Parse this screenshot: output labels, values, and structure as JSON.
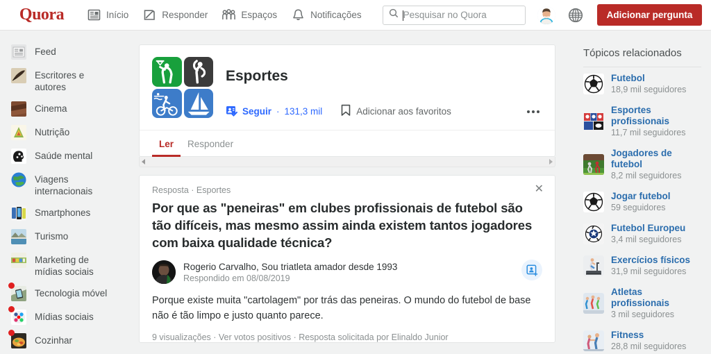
{
  "header": {
    "logo": "Quora",
    "nav": [
      {
        "label": "Início",
        "icon": "home-feed-icon"
      },
      {
        "label": "Responder",
        "icon": "pencil-answer-icon"
      },
      {
        "label": "Espaços",
        "icon": "spaces-people-icon"
      },
      {
        "label": "Notificações",
        "icon": "bell-icon"
      }
    ],
    "search": {
      "placeholder": "Pesquisar no Quora",
      "value": ""
    },
    "avatar": "user-avatar",
    "globe": "globe-language-icon",
    "add_question_label": "Adicionar pergunta",
    "accent_color": "#b92b27"
  },
  "sidebar": {
    "items": [
      {
        "label": "Feed",
        "icon": "feed-icon",
        "badge": false
      },
      {
        "label": "Escritores e autores",
        "icon": "writers-authors-icon",
        "badge": false
      },
      {
        "label": "Cinema",
        "icon": "cinema-icon",
        "badge": false
      },
      {
        "label": "Nutrição",
        "icon": "nutrition-icon",
        "badge": false
      },
      {
        "label": "Saúde mental",
        "icon": "mental-health-icon",
        "badge": false
      },
      {
        "label": "Viagens internacionais",
        "icon": "international-travel-icon",
        "badge": false
      },
      {
        "label": "Smartphones",
        "icon": "smartphones-icon",
        "badge": false
      },
      {
        "label": "Turismo",
        "icon": "tourism-icon",
        "badge": false
      },
      {
        "label": "Marketing de mídias sociais",
        "icon": "social-media-marketing-icon",
        "badge": false
      },
      {
        "label": "Tecnologia móvel",
        "icon": "mobile-technology-icon",
        "badge": true
      },
      {
        "label": "Mídias sociais",
        "icon": "social-media-icon",
        "badge": true
      },
      {
        "label": "Cozinhar",
        "icon": "cooking-icon",
        "badge": true
      }
    ]
  },
  "topic": {
    "title": "Esportes",
    "follow_label": "Seguir",
    "follow_separator": "·",
    "follow_count": "131,3 mil",
    "bookmark_label": "Adicionar aos favoritos",
    "more_label": "more-options",
    "tabs": [
      {
        "label": "Ler",
        "active": true
      },
      {
        "label": "Responder",
        "active": false
      }
    ]
  },
  "answer": {
    "meta": "Resposta · Esportes",
    "close_label": "✕",
    "title": "Por que as \"peneiras\" em clubes profissionais de futebol são tão difíceis, mas mesmo assim ainda existem tantos jogadores com baixa qualidade técnica?",
    "author_name": "Rogerio Carvalho, Sou triatleta amador desde 1993",
    "answered_on": "Respondido em 08/08/2019",
    "body": "Porque existe muita \"cartolagem\" por trás das peneiras. O mundo do futebol de base não é tão limpo e justo quanto parece.",
    "footer": "9 visualizações · Ver votos positivos · Resposta solicitada por Elinaldo Junior"
  },
  "related": {
    "title": "Tópicos relacionados",
    "items": [
      {
        "name": "Futebol",
        "followers": "18,9 mil seguidores",
        "icon": "soccer-ball-icon"
      },
      {
        "name": "Esportes profissionais",
        "followers": "11,7 mil seguidores",
        "icon": "pro-leagues-icon"
      },
      {
        "name": "Jogadores de futebol",
        "followers": "8,2 mil seguidores",
        "icon": "soccer-players-icon"
      },
      {
        "name": "Jogar futebol",
        "followers": "59 seguidores",
        "icon": "soccer-ball-icon"
      },
      {
        "name": "Futebol Europeu",
        "followers": "3,4 mil seguidores",
        "icon": "euro-football-icon"
      },
      {
        "name": "Exercícios físicos",
        "followers": "31,9 mil seguidores",
        "icon": "treadmill-icon"
      },
      {
        "name": "Atletas profissionais",
        "followers": "3 mil seguidores",
        "icon": "athletes-icon"
      },
      {
        "name": "Fitness",
        "followers": "28,8 mil seguidores",
        "icon": "fitness-icon"
      }
    ]
  }
}
